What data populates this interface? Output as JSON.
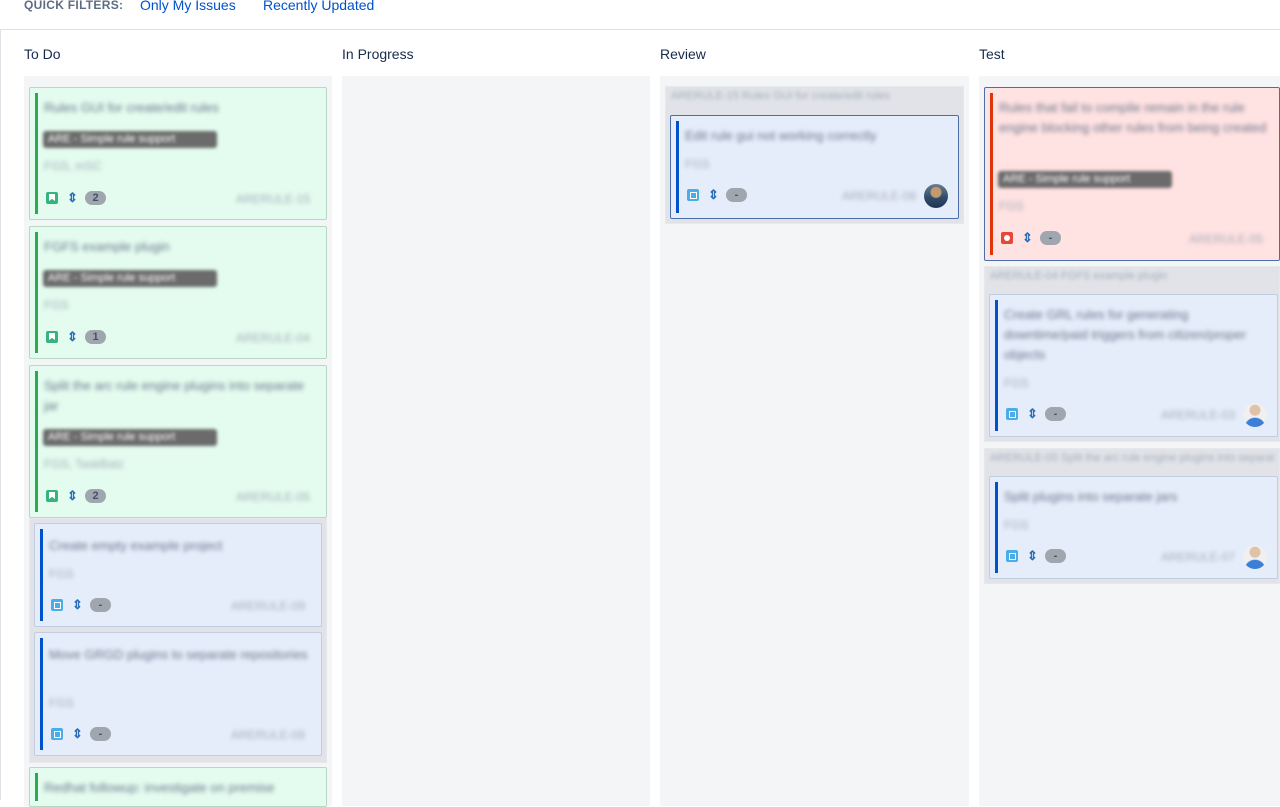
{
  "quick_filters": {
    "label": "QUICK FILTERS:",
    "items": [
      "Only My Issues",
      "Recently Updated"
    ]
  },
  "columns": [
    {
      "title": "To Do"
    },
    {
      "title": "In Progress"
    },
    {
      "title": "Review"
    },
    {
      "title": "Test"
    }
  ],
  "todo_cards": [
    {
      "summary": "Rules GUI for create/edit rules",
      "epic": "ARE - Simple rule support",
      "labels": "FGS, mSC",
      "subtasks": "2",
      "key": "ARERULE-15"
    },
    {
      "summary": "FGFS example plugin",
      "epic": "ARE - Simple rule support",
      "labels": "FGS",
      "subtasks": "1",
      "key": "ARERULE-04"
    },
    {
      "summary": "Split the arc rule engine plugins into separate jar",
      "epic": "ARE - Simple rule support",
      "labels": "FGS, TaskBatz",
      "subtasks": "2",
      "key": "ARERULE-05"
    },
    {
      "summary": "Create empty example project",
      "labels": "FGS",
      "subtasks": "-",
      "key": "ARERULE-09"
    },
    {
      "summary": "Move GRGD plugins to separate repositories",
      "labels": "FGS",
      "subtasks": "-",
      "key": "ARERULE-09"
    },
    {
      "summary": "Redhat followup: investigate on premise"
    }
  ],
  "review": {
    "parent": "ARERULE-15 Rules GUI for create/edit rules",
    "card": {
      "summary": "Edit rule gui not working correctly",
      "labels": "FGS",
      "subtasks": "-",
      "key": "ARERULE-08"
    }
  },
  "test": {
    "bug_card": {
      "summary": "Rules that fail to compile remain in the rule engine blocking other rules from being created",
      "epic": "ARE - Simple rule support",
      "labels": "FGS",
      "subtasks": "-",
      "key": "ARERULE-05"
    },
    "parent_1": "ARERULE-04 FGFS example plugin",
    "card_1": {
      "summary": "Create GRL rules for generating downtime/paid triggers from citizen/proper objects",
      "labels": "FGS",
      "subtasks": "-",
      "key": "ARERULE-03"
    },
    "parent_2": "ARERULE-05 Split the arc rule engine plugins into separate jar",
    "card_2": {
      "summary": "Split plugins into separate jars",
      "labels": "FGS",
      "subtasks": "-",
      "key": "ARERULE-07"
    }
  },
  "icons": {
    "story": "story-bookmark-icon",
    "task": "subtask-icon",
    "bug": "bug-icon",
    "priority": "priority-arrows-icon"
  },
  "colors": {
    "story_bg": "#e3fcef",
    "task_bg": "#e6edfa",
    "bug_bg": "#ffe2e2",
    "link": "#0052cc"
  }
}
